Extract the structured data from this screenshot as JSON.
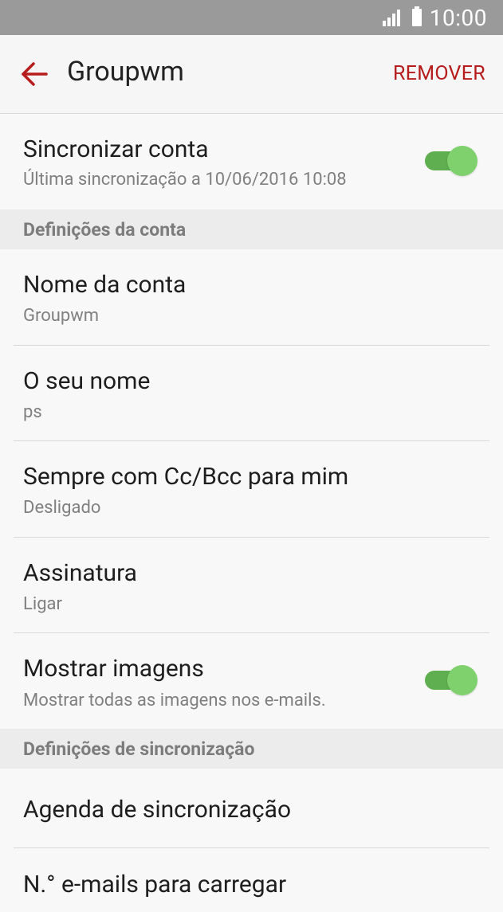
{
  "status_bar": {
    "time": "10:00"
  },
  "app_bar": {
    "title": "Groupwm",
    "action": "REMOVER"
  },
  "sync_account": {
    "title": "Sincronizar conta",
    "subtitle": "Última sincronização a 10/06/2016 10:08",
    "enabled": true
  },
  "sections": {
    "account_settings": "Definições da conta",
    "sync_settings": "Definições de sincronização"
  },
  "account_settings": [
    {
      "title": "Nome da conta",
      "subtitle": "Groupwm"
    },
    {
      "title": "O seu nome",
      "subtitle": "ps"
    },
    {
      "title": "Sempre com Cc/Bcc para mim",
      "subtitle": "Desligado"
    },
    {
      "title": "Assinatura",
      "subtitle": "Ligar"
    }
  ],
  "show_images": {
    "title": "Mostrar imagens",
    "subtitle": "Mostrar todas as imagens nos e-mails.",
    "enabled": true
  },
  "sync_settings": [
    {
      "title": "Agenda de sincronização"
    },
    {
      "title": "N.° e-mails para carregar"
    }
  ],
  "colors": {
    "accent": "#b71c1c",
    "toggle_on": "#7ed16d",
    "status_bar": "#9a9a9a"
  }
}
